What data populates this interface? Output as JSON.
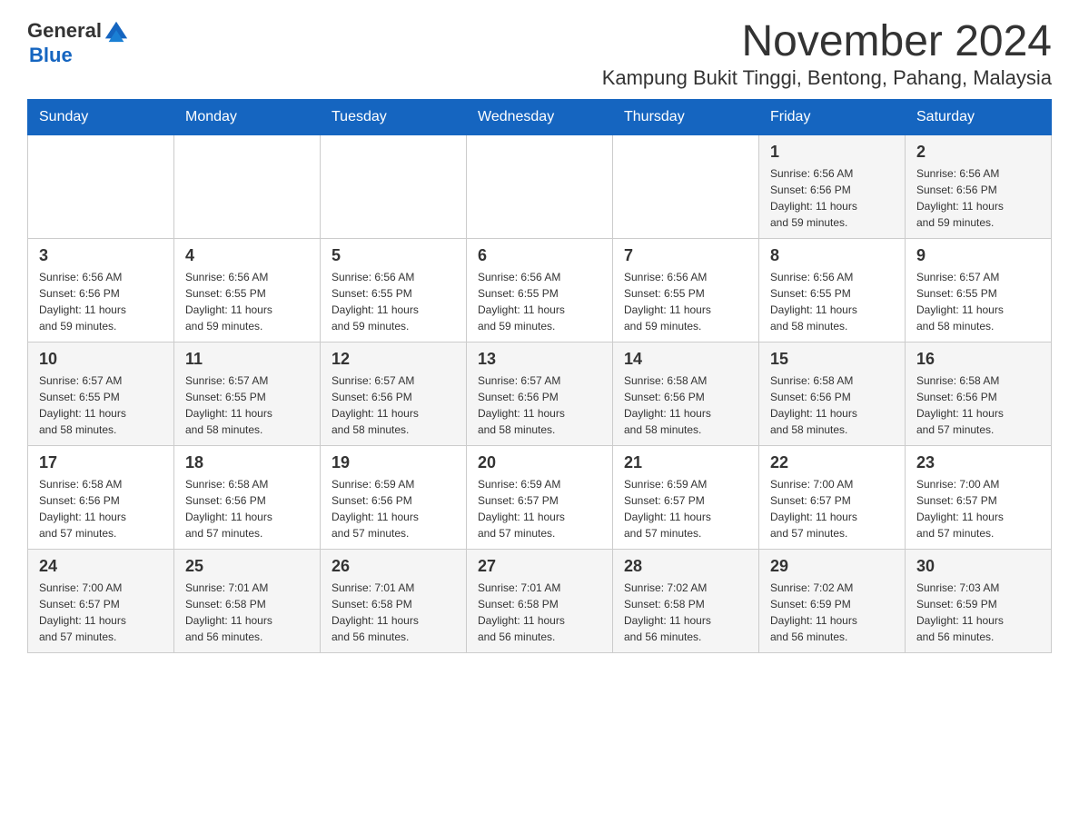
{
  "header": {
    "logo_general": "General",
    "logo_blue": "Blue",
    "month_title": "November 2024",
    "location": "Kampung Bukit Tinggi, Bentong, Pahang, Malaysia"
  },
  "days_of_week": [
    "Sunday",
    "Monday",
    "Tuesday",
    "Wednesday",
    "Thursday",
    "Friday",
    "Saturday"
  ],
  "weeks": [
    {
      "days": [
        {
          "num": "",
          "info": ""
        },
        {
          "num": "",
          "info": ""
        },
        {
          "num": "",
          "info": ""
        },
        {
          "num": "",
          "info": ""
        },
        {
          "num": "",
          "info": ""
        },
        {
          "num": "1",
          "info": "Sunrise: 6:56 AM\nSunset: 6:56 PM\nDaylight: 11 hours\nand 59 minutes."
        },
        {
          "num": "2",
          "info": "Sunrise: 6:56 AM\nSunset: 6:56 PM\nDaylight: 11 hours\nand 59 minutes."
        }
      ]
    },
    {
      "days": [
        {
          "num": "3",
          "info": "Sunrise: 6:56 AM\nSunset: 6:56 PM\nDaylight: 11 hours\nand 59 minutes."
        },
        {
          "num": "4",
          "info": "Sunrise: 6:56 AM\nSunset: 6:55 PM\nDaylight: 11 hours\nand 59 minutes."
        },
        {
          "num": "5",
          "info": "Sunrise: 6:56 AM\nSunset: 6:55 PM\nDaylight: 11 hours\nand 59 minutes."
        },
        {
          "num": "6",
          "info": "Sunrise: 6:56 AM\nSunset: 6:55 PM\nDaylight: 11 hours\nand 59 minutes."
        },
        {
          "num": "7",
          "info": "Sunrise: 6:56 AM\nSunset: 6:55 PM\nDaylight: 11 hours\nand 59 minutes."
        },
        {
          "num": "8",
          "info": "Sunrise: 6:56 AM\nSunset: 6:55 PM\nDaylight: 11 hours\nand 58 minutes."
        },
        {
          "num": "9",
          "info": "Sunrise: 6:57 AM\nSunset: 6:55 PM\nDaylight: 11 hours\nand 58 minutes."
        }
      ]
    },
    {
      "days": [
        {
          "num": "10",
          "info": "Sunrise: 6:57 AM\nSunset: 6:55 PM\nDaylight: 11 hours\nand 58 minutes."
        },
        {
          "num": "11",
          "info": "Sunrise: 6:57 AM\nSunset: 6:55 PM\nDaylight: 11 hours\nand 58 minutes."
        },
        {
          "num": "12",
          "info": "Sunrise: 6:57 AM\nSunset: 6:56 PM\nDaylight: 11 hours\nand 58 minutes."
        },
        {
          "num": "13",
          "info": "Sunrise: 6:57 AM\nSunset: 6:56 PM\nDaylight: 11 hours\nand 58 minutes."
        },
        {
          "num": "14",
          "info": "Sunrise: 6:58 AM\nSunset: 6:56 PM\nDaylight: 11 hours\nand 58 minutes."
        },
        {
          "num": "15",
          "info": "Sunrise: 6:58 AM\nSunset: 6:56 PM\nDaylight: 11 hours\nand 58 minutes."
        },
        {
          "num": "16",
          "info": "Sunrise: 6:58 AM\nSunset: 6:56 PM\nDaylight: 11 hours\nand 57 minutes."
        }
      ]
    },
    {
      "days": [
        {
          "num": "17",
          "info": "Sunrise: 6:58 AM\nSunset: 6:56 PM\nDaylight: 11 hours\nand 57 minutes."
        },
        {
          "num": "18",
          "info": "Sunrise: 6:58 AM\nSunset: 6:56 PM\nDaylight: 11 hours\nand 57 minutes."
        },
        {
          "num": "19",
          "info": "Sunrise: 6:59 AM\nSunset: 6:56 PM\nDaylight: 11 hours\nand 57 minutes."
        },
        {
          "num": "20",
          "info": "Sunrise: 6:59 AM\nSunset: 6:57 PM\nDaylight: 11 hours\nand 57 minutes."
        },
        {
          "num": "21",
          "info": "Sunrise: 6:59 AM\nSunset: 6:57 PM\nDaylight: 11 hours\nand 57 minutes."
        },
        {
          "num": "22",
          "info": "Sunrise: 7:00 AM\nSunset: 6:57 PM\nDaylight: 11 hours\nand 57 minutes."
        },
        {
          "num": "23",
          "info": "Sunrise: 7:00 AM\nSunset: 6:57 PM\nDaylight: 11 hours\nand 57 minutes."
        }
      ]
    },
    {
      "days": [
        {
          "num": "24",
          "info": "Sunrise: 7:00 AM\nSunset: 6:57 PM\nDaylight: 11 hours\nand 57 minutes."
        },
        {
          "num": "25",
          "info": "Sunrise: 7:01 AM\nSunset: 6:58 PM\nDaylight: 11 hours\nand 56 minutes."
        },
        {
          "num": "26",
          "info": "Sunrise: 7:01 AM\nSunset: 6:58 PM\nDaylight: 11 hours\nand 56 minutes."
        },
        {
          "num": "27",
          "info": "Sunrise: 7:01 AM\nSunset: 6:58 PM\nDaylight: 11 hours\nand 56 minutes."
        },
        {
          "num": "28",
          "info": "Sunrise: 7:02 AM\nSunset: 6:58 PM\nDaylight: 11 hours\nand 56 minutes."
        },
        {
          "num": "29",
          "info": "Sunrise: 7:02 AM\nSunset: 6:59 PM\nDaylight: 11 hours\nand 56 minutes."
        },
        {
          "num": "30",
          "info": "Sunrise: 7:03 AM\nSunset: 6:59 PM\nDaylight: 11 hours\nand 56 minutes."
        }
      ]
    }
  ],
  "accent_color": "#1565c0"
}
